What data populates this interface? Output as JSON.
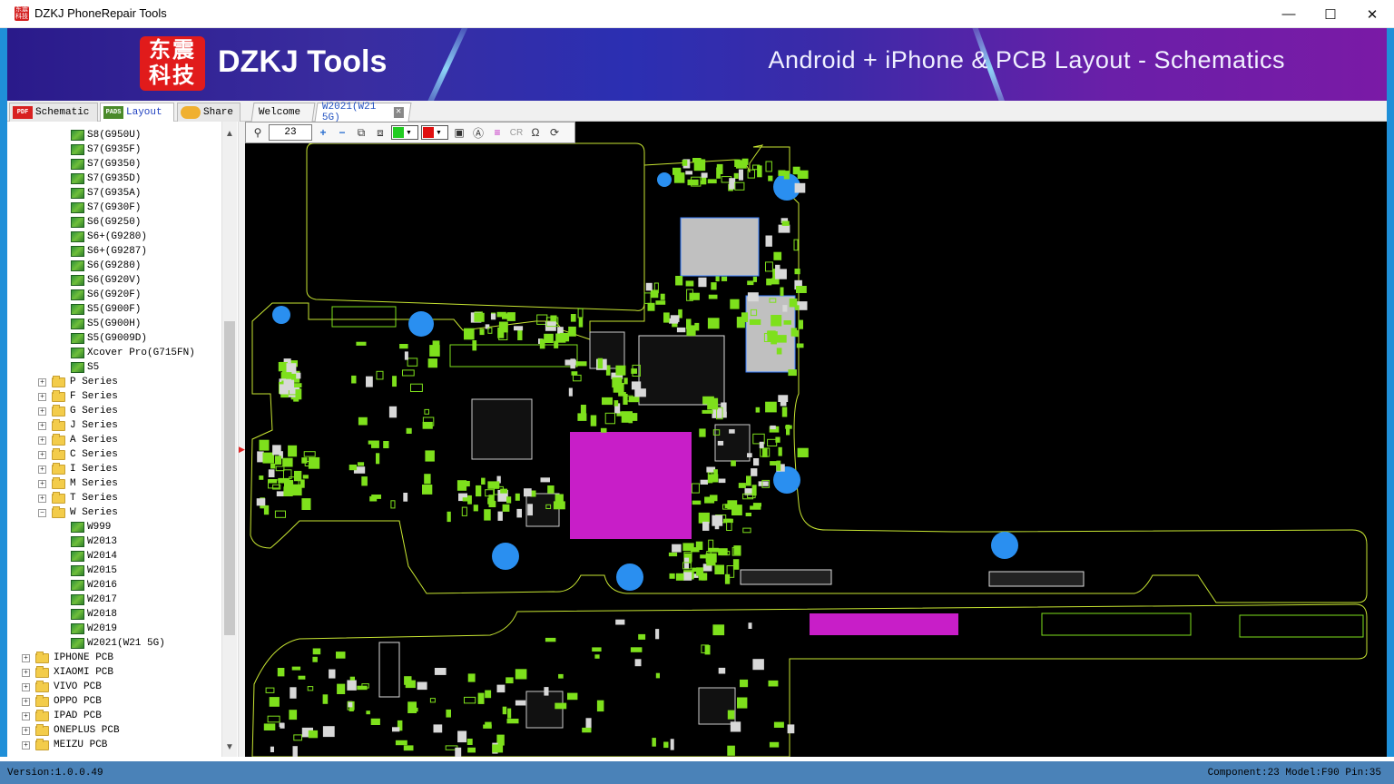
{
  "window": {
    "title": "DZKJ PhoneRepair Tools",
    "minimize_glyph": "—",
    "maximize_glyph": "☐",
    "close_glyph": "✕",
    "app_icon_text": "东震科技"
  },
  "banner": {
    "logo_chars": "东震科技",
    "logo_text": "DZKJ Tools",
    "tagline": "Android + iPhone & PCB Layout - Schematics"
  },
  "side_tabs": [
    {
      "label": "Schematic",
      "icon": "pdf-icon",
      "icon_text": "PDF"
    },
    {
      "label": "Layout",
      "icon": "pads-icon",
      "icon_text": "PADS"
    },
    {
      "label": "Share",
      "icon": "share-icon",
      "icon_text": ""
    }
  ],
  "doc_tabs": [
    {
      "label": "Welcome"
    },
    {
      "label": "W2021(W21 5G)"
    }
  ],
  "tree": {
    "boards_top": [
      "S8(G950U)",
      "S7(G935F)",
      "S7(G9350)",
      "S7(G935D)",
      "S7(G935A)",
      "S7(G930F)",
      "S6(G9250)",
      "S6+(G9280)",
      "S6+(G9287)",
      "S6(G9280)",
      "S6(G920V)",
      "S6(G920F)",
      "S5(G900F)",
      "S5(G900H)",
      "S5(G9009D)",
      "Xcover Pro(G715FN)",
      "S5"
    ],
    "series": [
      "P Series",
      "F Series",
      "G Series",
      "J Series",
      "A Series",
      "C Series",
      "I Series",
      "M Series",
      "T Series",
      "W Series"
    ],
    "w_boards": [
      "W999",
      "W2013",
      "W2014",
      "W2015",
      "W2016",
      "W2017",
      "W2018",
      "W2019",
      "W2021(W21 5G)"
    ],
    "brands": [
      "IPHONE PCB",
      "XIAOMI PCB",
      "VIVO PCB",
      "OPPO PCB",
      "IPAD PCB",
      "ONEPLUS PCB",
      "MEIZU PCB"
    ],
    "expand_glyph": "+",
    "collapse_glyph": "−"
  },
  "toolbar": {
    "zoom_value": "23",
    "search_glyph": "⚲",
    "zoom_in_glyph": "+",
    "zoom_out_glyph": "−",
    "cr_label": "CR",
    "ohm_glyph": "Ω",
    "color_top": "#22cc22",
    "color_bottom": "#e01010"
  },
  "status": {
    "version": "Version:1.0.0.49",
    "info": "Component:23 Model:F90 Pin:35"
  },
  "colors": {
    "pcb_outline": "#c8e632",
    "component_green": "#7ee01c",
    "via_blue": "#2a8ff0",
    "soc_magenta": "#c81ec8",
    "chip_gray": "#c0c0c0",
    "statusbar": "#4a82b8"
  }
}
